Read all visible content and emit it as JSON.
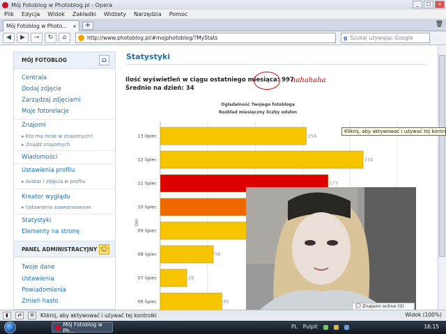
{
  "window": {
    "title": "Mój Fotoblog w Photoblog.pl - Opera"
  },
  "menu": [
    "Plik",
    "Edycja",
    "Widok",
    "Zakładki",
    "Widżety",
    "Narzędzia",
    "Pomoc"
  ],
  "tab": {
    "label": "Mój Fotoblog w Photo...",
    "close": "×",
    "new": "+"
  },
  "nav": {
    "back": "◀",
    "forward": "▶",
    "wand": "⊸",
    "reload": "↻",
    "home": "⌂",
    "url": "http://www.photoblog.pl/#mojphotoblog/?MyStats",
    "search_placeholder": "Szukaj używając Google",
    "search_engine": "g"
  },
  "sidebar": {
    "section1": "MÓJ FOTOBLOG",
    "links": [
      "Centrala",
      "Dodaj zdjęcie",
      "Zarządzaj zdjęciami",
      "Moje fotorelacje",
      "Znajomi",
      "Wiadomości",
      "Ustawienia profilu",
      "Kreator wyglądu",
      "Statystyki",
      "Elementy na stronę"
    ],
    "sub_znajomi": [
      "Kto ma mnie w znajomych?",
      "Znajdź znajomych"
    ],
    "sub_profil": [
      "Avatar i zdjęcia w profilu"
    ],
    "sub_kreator": [
      "Ustawienia zaawansowane"
    ],
    "section2": "PANEL ADMINISTRACYJNY",
    "admin_links": [
      "Twoje dane",
      "Ustawienia",
      "Powiadomienia",
      "Zmień hasło"
    ]
  },
  "main": {
    "title": "Statystyki",
    "views_label": "Ilość wyświetleń w ciągu ostatniego miesiąca:",
    "views_value": "997",
    "avg_label": "Średnio na dzień: 34",
    "annotation": "hahahaha"
  },
  "chart_data": {
    "type": "bar",
    "orientation": "horizontal",
    "title": "Ogladalność Twojego fotobloga",
    "subtitle": "Rozkład miesięczny liczby odsłon",
    "ylabel": "Dni",
    "categories": [
      "13 lipiec",
      "12 lipiec",
      "11 lipiec",
      "10 lipiec",
      "09 lipiec",
      "08 lipiec",
      "07 lipiec",
      "06 lipiec"
    ],
    "values": [
      154,
      214,
      177,
      160,
      160,
      56,
      28,
      65
    ],
    "value_labels": [
      "154",
      "214",
      "177",
      "",
      "160",
      "56",
      "28",
      "65"
    ],
    "colors": [
      "#f7c400",
      "#f7c400",
      "#dd0000",
      "#ee6a00",
      "#f7c400",
      "#f7c400",
      "#f7c400",
      "#f7c400"
    ],
    "xlim": [
      0,
      250
    ],
    "grid": true
  },
  "tooltip": "Kliknij, aby aktywować i używać tej kontrolki",
  "status": {
    "text": "Kliknij, aby aktywować i używać tej kontrolki",
    "zoom": "Widok (100%)",
    "online": "Znajomi online (0)"
  },
  "taskbar": {
    "item": "Mój Fotoblog w Ph...",
    "lang": "PL",
    "desktop": "Pulpit",
    "clock": "16:15"
  }
}
